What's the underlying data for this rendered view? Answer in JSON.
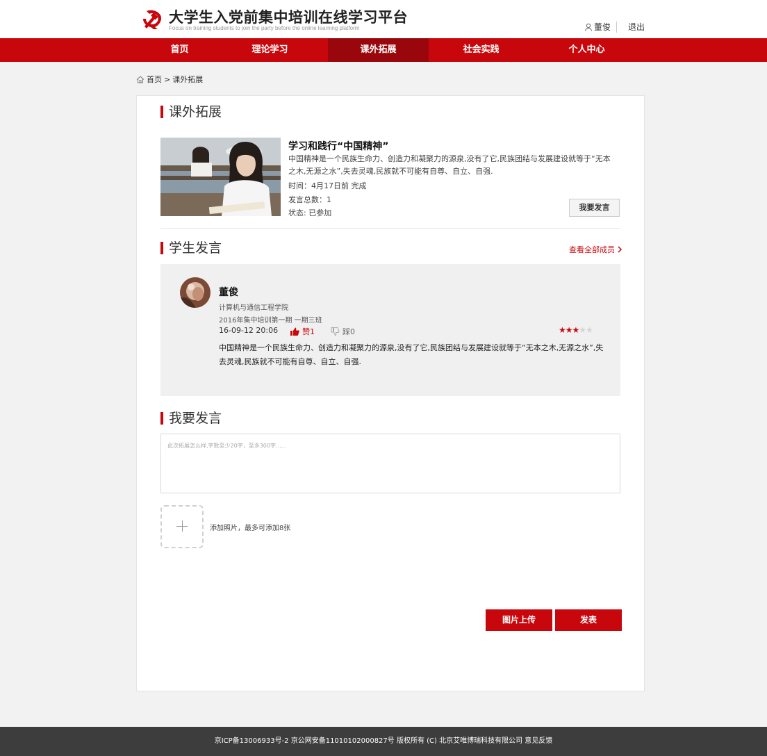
{
  "header": {
    "title": "大学生入党前集中培训在线学习平台",
    "subtitle": "Focus on training students to join the party before the online learning platform",
    "user_name": "董俊",
    "logout_label": "退出"
  },
  "nav": {
    "items": [
      {
        "label": "首页"
      },
      {
        "label": "理论学习"
      },
      {
        "label": "课外拓展"
      },
      {
        "label": "社会实践"
      },
      {
        "label": "个人中心"
      }
    ],
    "active_index": 2
  },
  "breadcrumb": {
    "home": "首页",
    "separator": ">",
    "current": "课外拓展"
  },
  "activity": {
    "section_title": "课外拓展",
    "title": "学习和践行“中国精神”",
    "description": "中国精神是一个民族生命力、创造力和凝聚力的源泉,没有了它,民族团结与发展建设就等于“无本之木,无源之水”,失去灵魂,民族就不可能有自尊、自立、自强.",
    "time": "时间：4月17日前 完成",
    "speech_count": "发言总数：1",
    "status": "状态: 已参加",
    "speak_button": "我要发言"
  },
  "student_speech": {
    "section_title": "学生发言",
    "view_all_label": "查看全部成员",
    "comment": {
      "name": "董俊",
      "college": "计算机与通信工程学院",
      "class": "2016年集中培训第一期 一期三班",
      "datetime": "16-09-12 20:06",
      "like_label": "赞1",
      "dislike_label": "踩0",
      "rating": 3,
      "rating_max": 5,
      "text": "中国精神是一个民族生命力、创造力和凝聚力的源泉,没有了它,民族团结与发展建设就等于“无本之木,无源之水”,失去灵魂,民族就不可能有自尊、自立、自强."
    }
  },
  "my_speech": {
    "section_title": "我要发言",
    "placeholder": "此次拓展怎么样,字数至少20字，至多300字......",
    "add_photo_tip": "添加照片，最多可添加8张",
    "upload_button": "图片上传",
    "publish_button": "发表"
  },
  "footer": {
    "text": "京ICP备13006933号-2 京公网安备11010102000827号 版权所有 (C) 北京艾唯博瑞科技有限公司 意见反馈"
  },
  "colors": {
    "brand_red": "#c8070d",
    "nav_active": "#99070c",
    "footer_bg": "#3d3d3d"
  },
  "icons": [
    "party-emblem-icon",
    "user-icon",
    "home-icon",
    "chevron-right-icon",
    "thumbs-up-icon",
    "thumbs-down-icon",
    "star-icon",
    "plus-icon"
  ]
}
